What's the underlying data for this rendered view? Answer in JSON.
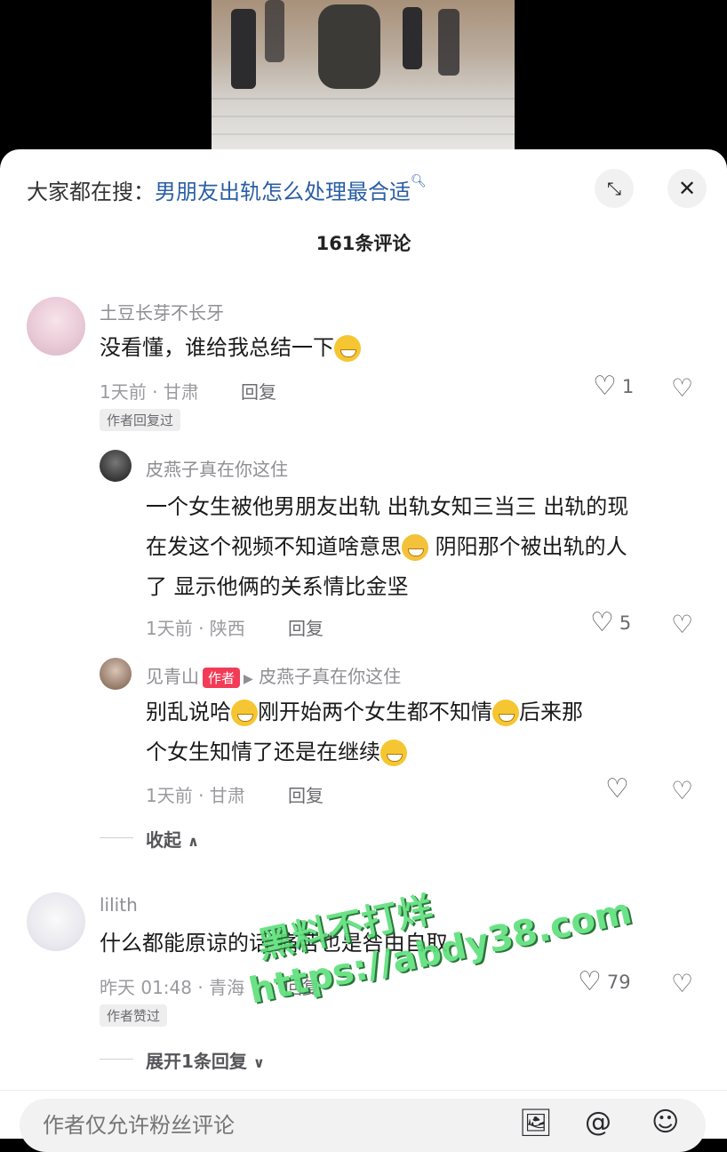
{
  "search": {
    "prefix": "大家都在搜：",
    "query": "男朋友出轨怎么处理最合适",
    "query_icon": "search-icon"
  },
  "header": {
    "expand_icon": "expand-icon",
    "close_icon": "close-icon"
  },
  "comment_count": "161条评论",
  "comments": [
    {
      "username": "土豆长芽不长牙",
      "text": "没看懂，谁给我总结一下",
      "emoji": "grimacing-sweat-emoji",
      "meta": "1天前 · 甘肃",
      "reply_label": "回复",
      "likes": "1",
      "tag": "作者回复过",
      "replies": [
        {
          "username": "皮燕子真在你这住",
          "text_line1": "一个女生被他男朋友出轨 出轨女知三当三 出轨的现",
          "text_line2a": "在发这个视频不知道啥意思",
          "text_line2b": " 阴阳那个被出轨的人",
          "text_line3": "了 显示他俩的关系情比金坚",
          "meta": "1天前 · 陕西",
          "reply_label": "回复",
          "likes": "5"
        },
        {
          "username": "见青山",
          "author_badge": "作者",
          "reply_to": "皮燕子真在你这住",
          "text_line1a": "别乱说哈",
          "text_line1b": "刚开始两个女生都不知情",
          "text_line1c": "后来那",
          "text_line2": "个女生知情了还是在继续",
          "meta": "1天前 · 甘肃",
          "reply_label": "回复",
          "likes": ""
        }
      ],
      "collapse_label": "收起"
    },
    {
      "username": "lilith",
      "text": "什么都能原谅的话 痛苦也是咎由自取",
      "meta": "昨天 01:48 · 青海",
      "reply_label": "回复",
      "likes": "79",
      "tag": "作者赞过",
      "expand_label": "展开1条回复"
    }
  ],
  "watermark": {
    "line1": "黑料不打烊",
    "line2": "https://abdy38.com"
  },
  "input": {
    "placeholder": "作者仅允许粉丝评论"
  },
  "toolbar_icons": [
    "image-icon",
    "at-icon",
    "emoji-icon"
  ]
}
